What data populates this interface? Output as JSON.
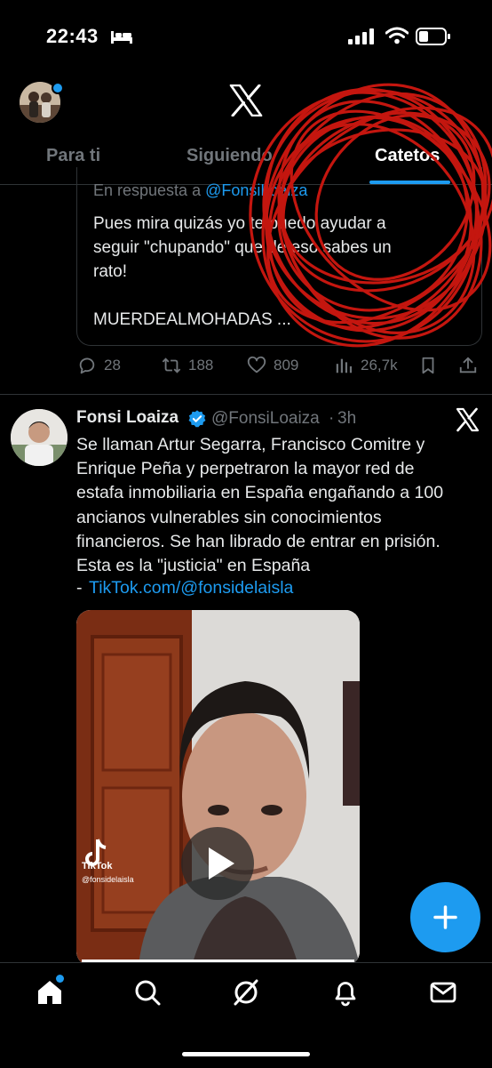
{
  "status_bar": {
    "time": "22:43"
  },
  "tabs": [
    {
      "label": "Para ti"
    },
    {
      "label": "Siguiendo"
    },
    {
      "label": "Catetos",
      "active": true
    }
  ],
  "quoted": {
    "reply_prefix": "En respuesta a ",
    "reply_handle": "@FonsiLoaiza",
    "text": "Pues mira quizás yo te puedo ayudar a\nseguir \"chupando\" que de eso sabes un\nrato!\n\nMUERDEALMOHADAS ..."
  },
  "actions": {
    "replies": "28",
    "retweets": "188",
    "likes": "809",
    "views": "26,7k"
  },
  "tweet": {
    "name": "Fonsi Loaiza",
    "handle": "@FonsiLoaiza",
    "separator": "·",
    "time": "3h",
    "text": "Se llaman Artur Segarra, Francisco Comitre y\nEnrique Peña y perpetraron la mayor red de\nestafa inmobiliaria en España engañando a 100\nancianos vulnerables sin conocimientos\nfinancieros. Se han librado de entrar en prisión.\nEsta es la \"justicia\" en España",
    "link_prefix": "-",
    "link": "TikTok.com/@fonsidelaisla",
    "video_watermark": "TikTok",
    "video_handle": "@fonsidelaisla"
  },
  "colors": {
    "accent": "#1d9bf0",
    "background": "#000000",
    "muted": "#71767b",
    "scribble": "#c4160f"
  },
  "icons": [
    "bed-icon",
    "signal-icon",
    "wifi-icon",
    "battery-icon",
    "x-logo-icon",
    "reply-icon",
    "retweet-icon",
    "like-icon",
    "views-icon",
    "bookmark-icon",
    "share-icon",
    "verified-icon",
    "grok-x-icon",
    "play-icon",
    "compose-icon",
    "home-icon",
    "search-icon",
    "grok-icon",
    "notifications-icon",
    "messages-icon"
  ]
}
